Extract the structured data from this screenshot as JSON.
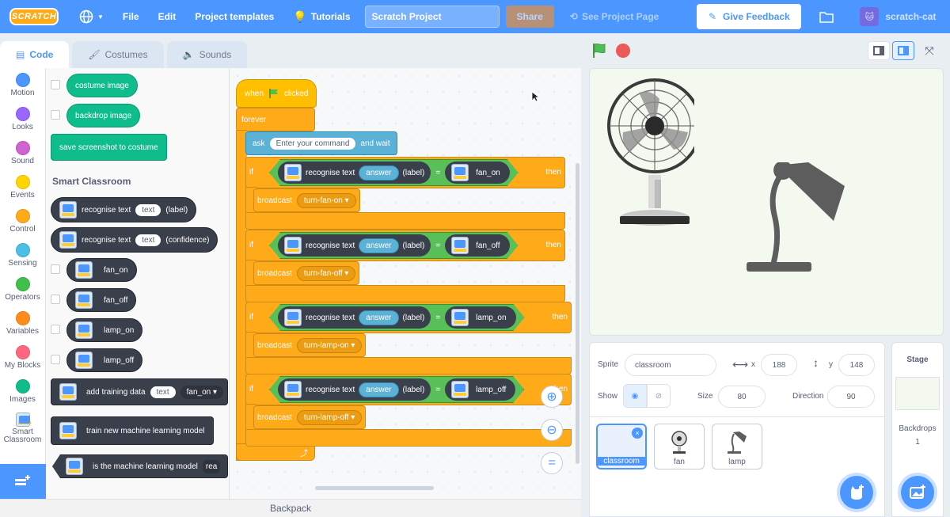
{
  "menu": {
    "logo": "SCRATCH",
    "file": "File",
    "edit": "Edit",
    "templates": "Project templates",
    "tutorials": "Tutorials",
    "project_title": "Scratch Project",
    "share": "Share",
    "see_page": "See Project Page",
    "feedback": "Give Feedback",
    "username": "scratch-cat"
  },
  "tabs": {
    "code": "Code",
    "costumes": "Costumes",
    "sounds": "Sounds"
  },
  "categories": [
    {
      "label": "Motion",
      "color": "#4c97ff"
    },
    {
      "label": "Looks",
      "color": "#9966ff"
    },
    {
      "label": "Sound",
      "color": "#cf63cf"
    },
    {
      "label": "Events",
      "color": "#ffd500"
    },
    {
      "label": "Control",
      "color": "#ffab19"
    },
    {
      "label": "Sensing",
      "color": "#4cbfe6"
    },
    {
      "label": "Operators",
      "color": "#40bf4a"
    },
    {
      "label": "Variables",
      "color": "#ff8c1a"
    },
    {
      "label": "My Blocks",
      "color": "#ff6680"
    },
    {
      "label": "Images",
      "color": "#0fbd8c"
    },
    {
      "label": "Smart Classroom",
      "color": "#4c97ff"
    }
  ],
  "palette": {
    "costume_image": "costume image",
    "backdrop_image": "backdrop image",
    "save_screenshot": "save screenshot to costume",
    "section": "Smart Classroom",
    "recognise_label": "recognise text",
    "text_pill": "text",
    "label_opt": "(label)",
    "confidence_opt": "(confidence)",
    "fan_on": "fan_on",
    "fan_off": "fan_off",
    "lamp_on": "lamp_on",
    "lamp_off": "lamp_off",
    "add_training": "add training data",
    "add_training_label": "fan_on",
    "train_model": "train new machine learning model",
    "is_model": "is the machine learning model",
    "is_model_tail": "rea"
  },
  "script": {
    "when": "when",
    "clicked": "clicked",
    "forever": "forever",
    "ask": "ask",
    "ask_prompt": "Enter your command",
    "and_wait": "and wait",
    "if": "if",
    "then": "then",
    "recognise": "recognise text",
    "answer": "answer",
    "label": "(label)",
    "eq": "=",
    "broadcast": "broadcast",
    "rows": [
      {
        "label": "fan_on",
        "message": "turn-fan-on"
      },
      {
        "label": "fan_off",
        "message": "turn-fan-off"
      },
      {
        "label": "lamp_on",
        "message": "turn-lamp-on"
      },
      {
        "label": "lamp_off",
        "message": "turn-lamp-off"
      }
    ],
    "zoom_reset": "="
  },
  "backpack": "Backpack",
  "sprite_info": {
    "sprite_label": "Sprite",
    "sprite_name": "classroom",
    "x_label": "x",
    "x": "188",
    "y_label": "y",
    "y": "148",
    "show_label": "Show",
    "size_label": "Size",
    "size": "80",
    "direction_label": "Direction",
    "direction": "90"
  },
  "sprites": [
    {
      "name": "classroom"
    },
    {
      "name": "fan"
    },
    {
      "name": "lamp"
    }
  ],
  "stage_pane": {
    "title": "Stage",
    "backdrops_label": "Backdrops",
    "backdrops_count": "1"
  }
}
